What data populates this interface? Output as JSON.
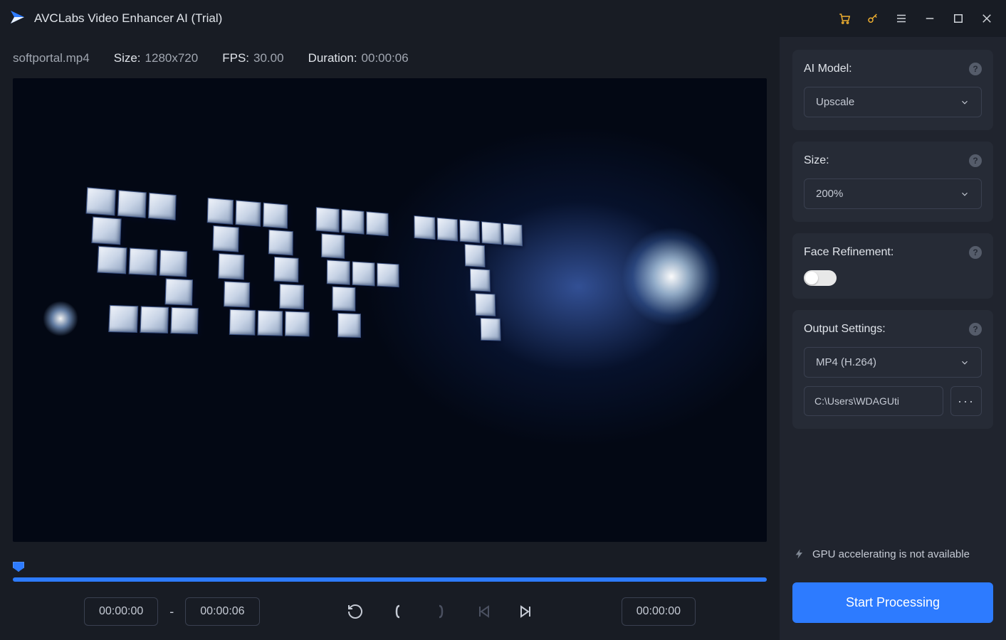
{
  "titlebar": {
    "app_title": "AVCLabs Video Enhancer AI (Trial)"
  },
  "file_info": {
    "filename": "softportal.mp4",
    "size_label": "Size:",
    "size_value": "1280x720",
    "fps_label": "FPS:",
    "fps_value": "30.00",
    "duration_label": "Duration:",
    "duration_value": "00:00:06"
  },
  "timeline": {
    "start_time": "00:00:00",
    "end_time": "00:00:06",
    "current_time": "00:00:00"
  },
  "sidebar": {
    "ai_model": {
      "label": "AI Model:",
      "value": "Upscale"
    },
    "size": {
      "label": "Size:",
      "value": "200%"
    },
    "face_refinement": {
      "label": "Face Refinement:"
    },
    "output": {
      "label": "Output Settings:",
      "format_value": "MP4 (H.264)",
      "path_value": "C:\\Users\\WDAGUti"
    },
    "gpu_status": "GPU accelerating is not available",
    "start_button": "Start Processing"
  }
}
